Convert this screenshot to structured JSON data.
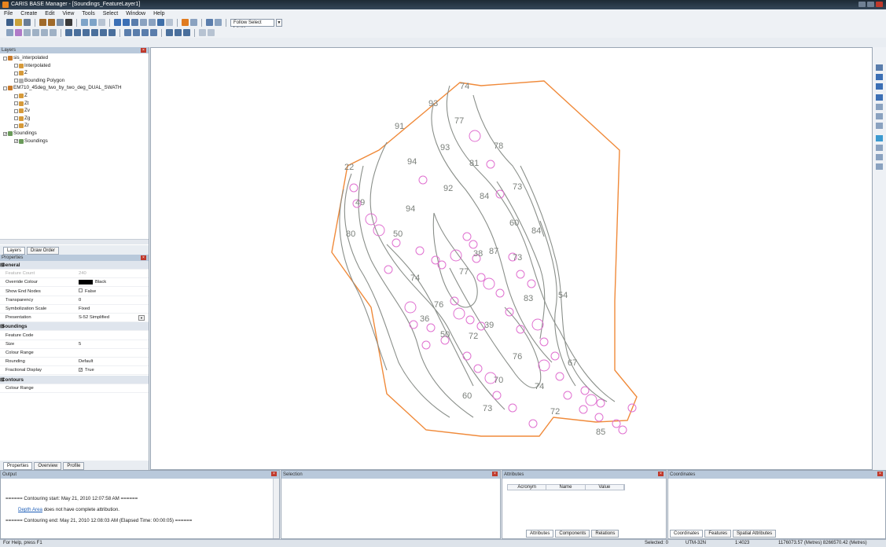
{
  "app": {
    "title": "CARIS BASE Manager - [Soundings_FeatureLayer1]"
  },
  "menu": [
    "File",
    "Create",
    "Edit",
    "View",
    "Tools",
    "Select",
    "Window",
    "Help"
  ],
  "toolbar": {
    "follow_select": "Follow Select Layer"
  },
  "layers_panel": {
    "title": "Layers",
    "items": [
      {
        "label": "sis_interpolated",
        "depth": 0,
        "checked": false,
        "icon": "folder-icon"
      },
      {
        "label": "Interpolated",
        "depth": 1,
        "checked": false,
        "icon": "surface-icon"
      },
      {
        "label": "Z",
        "depth": 1,
        "checked": false,
        "icon": "surface-icon"
      },
      {
        "label": "Bounding Polygon",
        "depth": 1,
        "checked": false,
        "icon": "polygon-icon"
      },
      {
        "label": "EM710_45deg_two_by_two_deg_DUAL_SWATH",
        "depth": 0,
        "checked": false,
        "icon": "folder-icon"
      },
      {
        "label": "Z",
        "depth": 1,
        "checked": false,
        "icon": "surface-icon"
      },
      {
        "label": "Zt",
        "depth": 1,
        "checked": false,
        "icon": "surface-icon"
      },
      {
        "label": "Zv",
        "depth": 1,
        "checked": false,
        "icon": "surface-icon"
      },
      {
        "label": "Zg",
        "depth": 1,
        "checked": false,
        "icon": "surface-icon"
      },
      {
        "label": "Zr",
        "depth": 1,
        "checked": false,
        "icon": "surface-icon"
      },
      {
        "label": "Soundings",
        "depth": 0,
        "checked": true,
        "icon": "soundings-icon"
      },
      {
        "label": "Soundings",
        "depth": 1,
        "checked": true,
        "icon": "soundings-icon"
      }
    ],
    "tabs": [
      "Layers",
      "Draw Order"
    ]
  },
  "properties_panel": {
    "title": "Properties",
    "rows": [
      {
        "group": true,
        "key": "General"
      },
      {
        "key": "Feature Count",
        "value": "240",
        "disabled": true
      },
      {
        "key": "Override Colour",
        "value": "Black",
        "swatch": "#000000"
      },
      {
        "key": "Show End Nodes",
        "value": "False",
        "checkbox": true
      },
      {
        "key": "Transparency",
        "value": "0"
      },
      {
        "key": "Symbolization Scale",
        "value": "Fixed"
      },
      {
        "key": "Presentation",
        "value": "S-52 Simplified",
        "dropdown": true
      },
      {
        "group": true,
        "key": "Soundings"
      },
      {
        "key": "Feature Code",
        "value": ""
      },
      {
        "key": "Size",
        "value": "5"
      },
      {
        "key": "Colour Range",
        "value": ""
      },
      {
        "key": "Rounding",
        "value": "Default"
      },
      {
        "key": "Fractional Display",
        "value": "True",
        "checkbox": true
      },
      {
        "group": true,
        "key": "Contours"
      },
      {
        "key": "Colour Range",
        "value": ""
      }
    ],
    "tabs": [
      "Properties",
      "Overview",
      "Profile"
    ]
  },
  "map": {
    "boundary_color": "#f08a3a",
    "contour_color": "#8a8f8a",
    "circle_color": "#e070d0",
    "labels": [
      "74",
      "93",
      "77",
      "91",
      "78",
      "93",
      "94",
      "81",
      "73",
      "22",
      "92",
      "84",
      "94",
      "60",
      "49",
      "84",
      "50",
      "80",
      "38",
      "87",
      "74",
      "77",
      "73",
      "76",
      "83",
      "54",
      "36",
      "39",
      "72",
      "76",
      "50",
      "70",
      "67",
      "74",
      "72",
      "60",
      "73",
      "85"
    ]
  },
  "output_panel": {
    "title": "Output",
    "lines": [
      "====== Contouring start: May 21, 2010 12:07:58 AM ======",
      "does not have complete attribution.",
      "====== Contouring end: May 21, 2010 12:08:03 AM (Elapsed Time: 00:00:05) ======"
    ],
    "link": "Depth Area"
  },
  "selection_panel": {
    "title": "Selection"
  },
  "attributes_panel": {
    "title": "Attributes",
    "columns": [
      "Acronym",
      "Name",
      "Value"
    ],
    "tabs": [
      "Attributes",
      "Components",
      "Relations"
    ]
  },
  "coordinates_panel": {
    "title": "Coordinates",
    "tabs": [
      "Coordinates",
      "Features",
      "Spatial Attributes"
    ]
  },
  "status": {
    "help": "For Help, press F1",
    "selected": "Selected: 0",
    "projection": "UTM-32N",
    "scale": "1:4023",
    "coords": "1176073.57 (Metres)  8266570.42 (Metres)"
  }
}
